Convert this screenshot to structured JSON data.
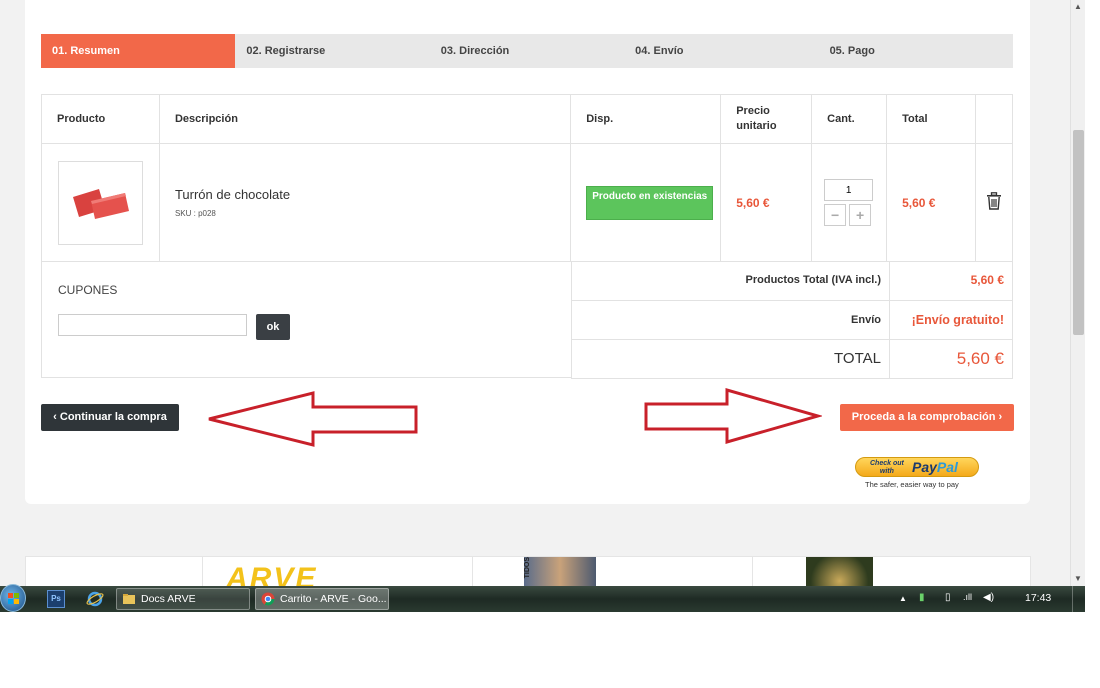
{
  "steps": [
    {
      "label": "01. Resumen"
    },
    {
      "label": "02. Registrarse"
    },
    {
      "label": "03. Dirección"
    },
    {
      "label": "04. Envío"
    },
    {
      "label": "05. Pago"
    }
  ],
  "cart": {
    "headers": {
      "producto": "Producto",
      "descripcion": "Descripción",
      "disp": "Disp.",
      "precio_line1": "Precio",
      "precio_line2": "unitario",
      "cant": "Cant.",
      "total": "Total"
    },
    "item": {
      "name": "Turrón de chocolate",
      "sku": "SKU : p028",
      "availability": "Producto en existencias",
      "unit_price": "5,60 €",
      "quantity": "1",
      "total": "5,60 €",
      "minus": "−",
      "plus": "+"
    }
  },
  "coupon": {
    "label": "CUPONES",
    "input_value": "",
    "ok_label": "ok"
  },
  "totals": {
    "products_label": "Productos Total (IVA incl.)",
    "products_value": "5,60 €",
    "shipping_label": "Envío",
    "shipping_value": "¡Envío gratuito!",
    "total_label": "TOTAL",
    "total_value": "5,60 €"
  },
  "actions": {
    "continue_label": "Continuar la compra",
    "proceed_label": "Proceda a la comprobación",
    "continue_icon": "chevron-left-icon",
    "proceed_icon": "chevron-right-icon"
  },
  "paypal": {
    "check_line1": "Check out",
    "check_line2": "with",
    "word_pay": "Pay",
    "word_pal": "Pal",
    "tagline": "The safer, easier way to pay"
  },
  "footer": {
    "arve_logo": "ARVE",
    "thumb_text": "TIDOS"
  },
  "taskbar": {
    "items": [
      {
        "label": "Docs ARVE"
      },
      {
        "label": "Carrito - ARVE - Goo..."
      }
    ],
    "ps_label": "Ps",
    "clock": "17:43"
  },
  "colors": {
    "accent": "#f26849",
    "price": "#e8573a",
    "stock": "#5cc55c",
    "dark_button": "#2f3539",
    "annotation_arrow": "#c8202a"
  }
}
